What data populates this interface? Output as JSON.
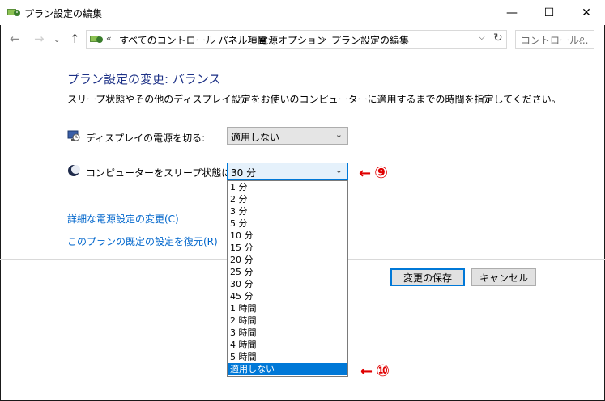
{
  "window": {
    "title": "プラン設定の編集",
    "minimize_glyph": "—",
    "maximize_glyph": "☐",
    "close_glyph": "✕"
  },
  "nav": {
    "back_glyph": "←",
    "forward_glyph": "→",
    "recent_glyph": "⌄",
    "up_glyph": "↑",
    "breadcrumb": {
      "overflow": "«",
      "items": [
        "すべてのコントロール パネル項目",
        "電源オプション",
        "プラン設定の編集"
      ],
      "separator": "›"
    },
    "dropdown_glyph": "⌵",
    "refresh_glyph": "↻",
    "search": {
      "placeholder": "コントロール...",
      "icon_glyph": "⌕"
    }
  },
  "page": {
    "heading": "プラン設定の変更: バランス",
    "description": "スリープ状態やその他のディスプレイ設定をお使いのコンピューターに適用するまでの時間を指定してください。",
    "display_off": {
      "label": "ディスプレイの電源を切る:",
      "value": "適用しない"
    },
    "sleep": {
      "label": "コンピューターをスリープ状態にする:",
      "value": "30 分"
    },
    "links": {
      "advanced": "詳細な電源設定の変更(C)",
      "restore": "このプランの既定の設定を復元(R)"
    },
    "buttons": {
      "save": "変更の保存",
      "cancel": "キャンセル"
    }
  },
  "sleep_dropdown": {
    "options": [
      "1 分",
      "2 分",
      "3 分",
      "5 分",
      "10 分",
      "15 分",
      "20 分",
      "25 分",
      "30 分",
      "45 分",
      "1 時間",
      "2 時間",
      "3 時間",
      "4 時間",
      "5 時間",
      "適用しない"
    ],
    "highlighted": "適用しない"
  },
  "annotations": {
    "arrow": "←",
    "nine": "⑨",
    "ten": "⑩",
    "color": "#e00000"
  },
  "colors": {
    "heading": "#1e3287",
    "link": "#0066cc",
    "selection": "#0078d7"
  },
  "icons": {
    "app": "power-plan-icon",
    "display": "display-power-icon",
    "sleep": "sleep-moon-icon"
  }
}
